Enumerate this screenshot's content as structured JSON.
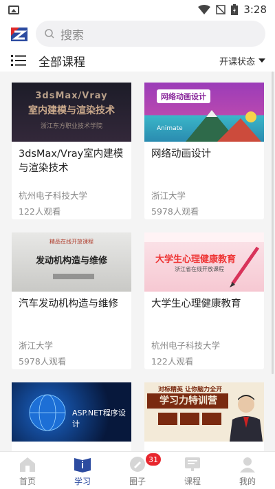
{
  "status_bar": {
    "time": "3:28"
  },
  "header": {
    "search_placeholder": "搜索"
  },
  "titlebar": {
    "title": "全部课程",
    "filter_label": "开课状态"
  },
  "courses": [
    {
      "thumb_title": "3dsMax/Vray 室内建模与渲染技术",
      "thumb_sub": "浙江东方职业技术学院",
      "title": "3dsMax/Vray室内建模与渲染技术",
      "school": "杭州电子科技大学",
      "views": "122人观看"
    },
    {
      "thumb_title": "网络动画设计",
      "thumb_sub": "Animate",
      "title": "网络动画设计",
      "school": "浙江大学",
      "views": "5978人观看"
    },
    {
      "thumb_title": "发动机构造与维修",
      "thumb_sub": "精品在线开放课程",
      "title": "汽车发动机构造与维修",
      "school": "浙江大学",
      "views": "5978人观看"
    },
    {
      "thumb_title": "大学生心理健康教育",
      "thumb_sub": "浙江省在线开放课程",
      "title": "大学生心理健康教育",
      "school": "杭州电子科技大学",
      "views": "122人观看"
    },
    {
      "thumb_title": "ASP.NET程序设计",
      "thumb_sub": "",
      "title": "",
      "school": "",
      "views": ""
    },
    {
      "thumb_title": "学习力特训营",
      "thumb_sub": "对标精英 让你脑力全开",
      "title": "",
      "school": "",
      "views": ""
    }
  ],
  "tabs": [
    {
      "label": "首页",
      "icon": "home-icon"
    },
    {
      "label": "学习",
      "icon": "study-icon"
    },
    {
      "label": "圈子",
      "icon": "circle-icon",
      "badge": "31"
    },
    {
      "label": "课程",
      "icon": "course-icon"
    },
    {
      "label": "我的",
      "icon": "profile-icon"
    }
  ],
  "colors": {
    "accent": "#2c4ba0",
    "badge": "#e8262d"
  }
}
